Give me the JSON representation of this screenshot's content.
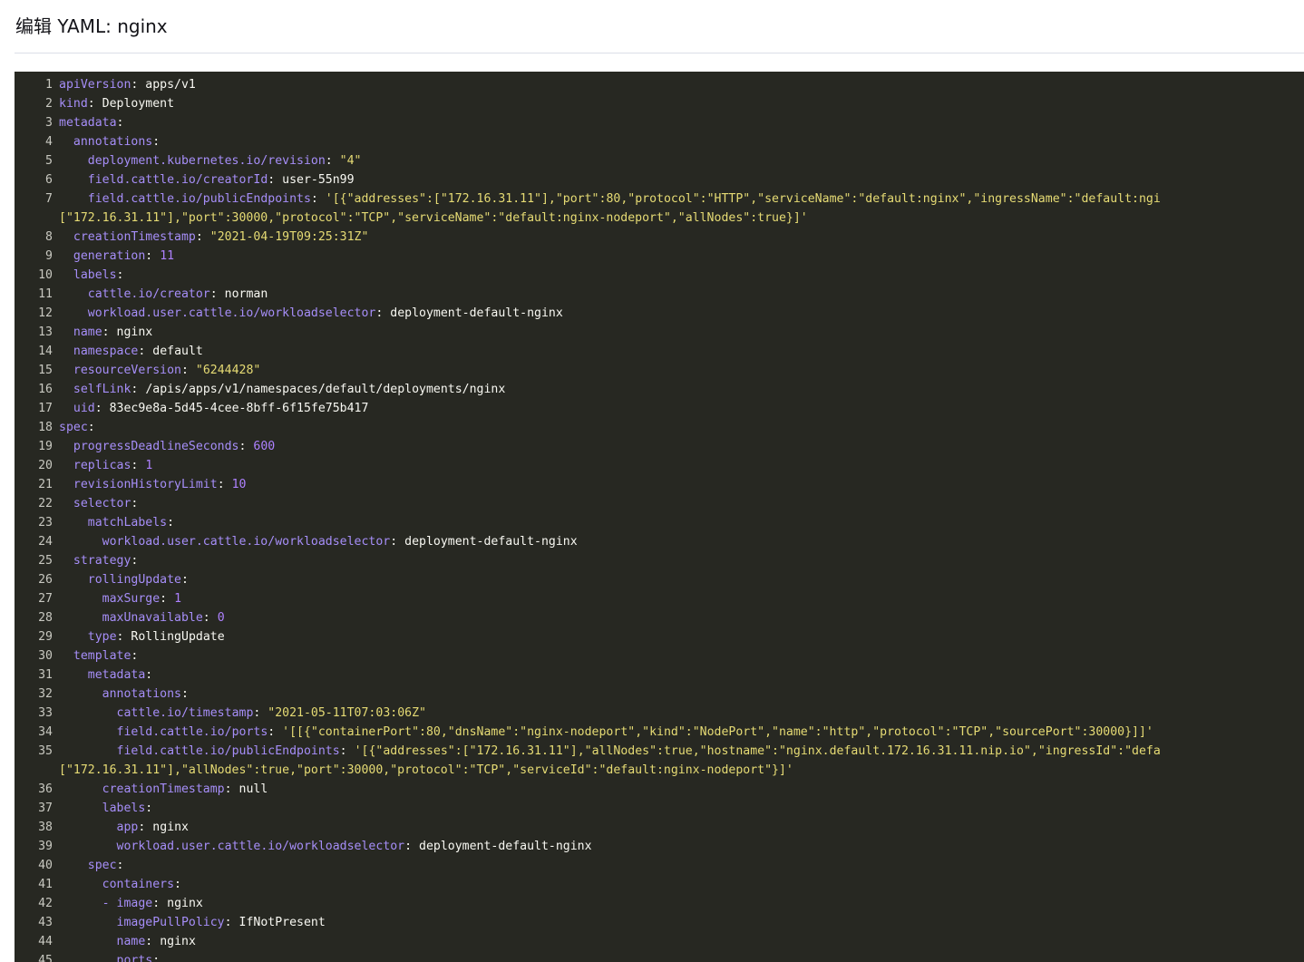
{
  "header": {
    "title": "编辑 YAML: nginx"
  },
  "editor": {
    "language": "yaml",
    "lines": [
      {
        "no": "1",
        "indent": 0,
        "key": "apiVersion",
        "sep": ": ",
        "value": "apps/v1",
        "vtype": "plain"
      },
      {
        "no": "2",
        "indent": 0,
        "key": "kind",
        "sep": ": ",
        "value": "Deployment",
        "vtype": "plain"
      },
      {
        "no": "3",
        "indent": 0,
        "key": "metadata",
        "sep": ":",
        "value": "",
        "vtype": "plain"
      },
      {
        "no": "4",
        "indent": 2,
        "key": "annotations",
        "sep": ":",
        "value": "",
        "vtype": "plain"
      },
      {
        "no": "5",
        "indent": 4,
        "key": "deployment.kubernetes.io/revision",
        "sep": ": ",
        "value": "\"4\"",
        "vtype": "string"
      },
      {
        "no": "6",
        "indent": 4,
        "key": "field.cattle.io/creatorId",
        "sep": ": ",
        "value": "user-55n99",
        "vtype": "plain"
      },
      {
        "no": "7",
        "indent": 4,
        "key": "field.cattle.io/publicEndpoints",
        "sep": ": ",
        "value": "'[{\"addresses\":[\"172.16.31.11\"],\"port\":80,\"protocol\":\"HTTP\",\"serviceName\":\"default:nginx\",\"ingressName\":\"default:ngi",
        "vtype": "string"
      },
      {
        "no": "",
        "indent": 0,
        "key": "",
        "sep": "",
        "value": "[\"172.16.31.11\"],\"port\":30000,\"protocol\":\"TCP\",\"serviceName\":\"default:nginx-nodeport\",\"allNodes\":true}]'",
        "vtype": "string",
        "wrap": true
      },
      {
        "no": "8",
        "indent": 2,
        "key": "creationTimestamp",
        "sep": ": ",
        "value": "\"2021-04-19T09:25:31Z\"",
        "vtype": "string"
      },
      {
        "no": "9",
        "indent": 2,
        "key": "generation",
        "sep": ": ",
        "value": "11",
        "vtype": "number"
      },
      {
        "no": "10",
        "indent": 2,
        "key": "labels",
        "sep": ":",
        "value": "",
        "vtype": "plain"
      },
      {
        "no": "11",
        "indent": 4,
        "key": "cattle.io/creator",
        "sep": ": ",
        "value": "norman",
        "vtype": "plain"
      },
      {
        "no": "12",
        "indent": 4,
        "key": "workload.user.cattle.io/workloadselector",
        "sep": ": ",
        "value": "deployment-default-nginx",
        "vtype": "plain"
      },
      {
        "no": "13",
        "indent": 2,
        "key": "name",
        "sep": ": ",
        "value": "nginx",
        "vtype": "plain"
      },
      {
        "no": "14",
        "indent": 2,
        "key": "namespace",
        "sep": ": ",
        "value": "default",
        "vtype": "plain"
      },
      {
        "no": "15",
        "indent": 2,
        "key": "resourceVersion",
        "sep": ": ",
        "value": "\"6244428\"",
        "vtype": "string"
      },
      {
        "no": "16",
        "indent": 2,
        "key": "selfLink",
        "sep": ": ",
        "value": "/apis/apps/v1/namespaces/default/deployments/nginx",
        "vtype": "plain"
      },
      {
        "no": "17",
        "indent": 2,
        "key": "uid",
        "sep": ": ",
        "value": "83ec9e8a-5d45-4cee-8bff-6f15fe75b417",
        "vtype": "plain"
      },
      {
        "no": "18",
        "indent": 0,
        "key": "spec",
        "sep": ":",
        "value": "",
        "vtype": "plain"
      },
      {
        "no": "19",
        "indent": 2,
        "key": "progressDeadlineSeconds",
        "sep": ": ",
        "value": "600",
        "vtype": "number"
      },
      {
        "no": "20",
        "indent": 2,
        "key": "replicas",
        "sep": ": ",
        "value": "1",
        "vtype": "number"
      },
      {
        "no": "21",
        "indent": 2,
        "key": "revisionHistoryLimit",
        "sep": ": ",
        "value": "10",
        "vtype": "number"
      },
      {
        "no": "22",
        "indent": 2,
        "key": "selector",
        "sep": ":",
        "value": "",
        "vtype": "plain"
      },
      {
        "no": "23",
        "indent": 4,
        "key": "matchLabels",
        "sep": ":",
        "value": "",
        "vtype": "plain"
      },
      {
        "no": "24",
        "indent": 6,
        "key": "workload.user.cattle.io/workloadselector",
        "sep": ": ",
        "value": "deployment-default-nginx",
        "vtype": "plain"
      },
      {
        "no": "25",
        "indent": 2,
        "key": "strategy",
        "sep": ":",
        "value": "",
        "vtype": "plain"
      },
      {
        "no": "26",
        "indent": 4,
        "key": "rollingUpdate",
        "sep": ":",
        "value": "",
        "vtype": "plain"
      },
      {
        "no": "27",
        "indent": 6,
        "key": "maxSurge",
        "sep": ": ",
        "value": "1",
        "vtype": "number"
      },
      {
        "no": "28",
        "indent": 6,
        "key": "maxUnavailable",
        "sep": ": ",
        "value": "0",
        "vtype": "number"
      },
      {
        "no": "29",
        "indent": 4,
        "key": "type",
        "sep": ": ",
        "value": "RollingUpdate",
        "vtype": "plain"
      },
      {
        "no": "30",
        "indent": 2,
        "key": "template",
        "sep": ":",
        "value": "",
        "vtype": "plain"
      },
      {
        "no": "31",
        "indent": 4,
        "key": "metadata",
        "sep": ":",
        "value": "",
        "vtype": "plain"
      },
      {
        "no": "32",
        "indent": 6,
        "key": "annotations",
        "sep": ":",
        "value": "",
        "vtype": "plain"
      },
      {
        "no": "33",
        "indent": 8,
        "key": "cattle.io/timestamp",
        "sep": ": ",
        "value": "\"2021-05-11T07:03:06Z\"",
        "vtype": "string"
      },
      {
        "no": "34",
        "indent": 8,
        "key": "field.cattle.io/ports",
        "sep": ": ",
        "value": "'[[{\"containerPort\":80,\"dnsName\":\"nginx-nodeport\",\"kind\":\"NodePort\",\"name\":\"http\",\"protocol\":\"TCP\",\"sourcePort\":30000}]]'",
        "vtype": "string"
      },
      {
        "no": "35",
        "indent": 8,
        "key": "field.cattle.io/publicEndpoints",
        "sep": ": ",
        "value": "'[{\"addresses\":[\"172.16.31.11\"],\"allNodes\":true,\"hostname\":\"nginx.default.172.16.31.11.nip.io\",\"ingressId\":\"defa",
        "vtype": "string"
      },
      {
        "no": "",
        "indent": 0,
        "key": "",
        "sep": "",
        "value": "[\"172.16.31.11\"],\"allNodes\":true,\"port\":30000,\"protocol\":\"TCP\",\"serviceId\":\"default:nginx-nodeport\"}]'",
        "vtype": "string",
        "wrap": true
      },
      {
        "no": "36",
        "indent": 6,
        "key": "creationTimestamp",
        "sep": ": ",
        "value": "null",
        "vtype": "plain"
      },
      {
        "no": "37",
        "indent": 6,
        "key": "labels",
        "sep": ":",
        "value": "",
        "vtype": "plain"
      },
      {
        "no": "38",
        "indent": 8,
        "key": "app",
        "sep": ": ",
        "value": "nginx",
        "vtype": "plain"
      },
      {
        "no": "39",
        "indent": 8,
        "key": "workload.user.cattle.io/workloadselector",
        "sep": ": ",
        "value": "deployment-default-nginx",
        "vtype": "plain"
      },
      {
        "no": "40",
        "indent": 4,
        "key": "spec",
        "sep": ":",
        "value": "",
        "vtype": "plain"
      },
      {
        "no": "41",
        "indent": 6,
        "key": "containers",
        "sep": ":",
        "value": "",
        "vtype": "plain"
      },
      {
        "no": "42",
        "indent": 6,
        "dash": "- ",
        "key": "image",
        "sep": ": ",
        "value": "nginx",
        "vtype": "plain"
      },
      {
        "no": "43",
        "indent": 8,
        "key": "imagePullPolicy",
        "sep": ": ",
        "value": "IfNotPresent",
        "vtype": "plain"
      },
      {
        "no": "44",
        "indent": 8,
        "key": "name",
        "sep": ": ",
        "value": "nginx",
        "vtype": "plain"
      },
      {
        "no": "45",
        "indent": 8,
        "key": "ports",
        "sep": ":",
        "value": "",
        "vtype": "plain"
      }
    ]
  }
}
